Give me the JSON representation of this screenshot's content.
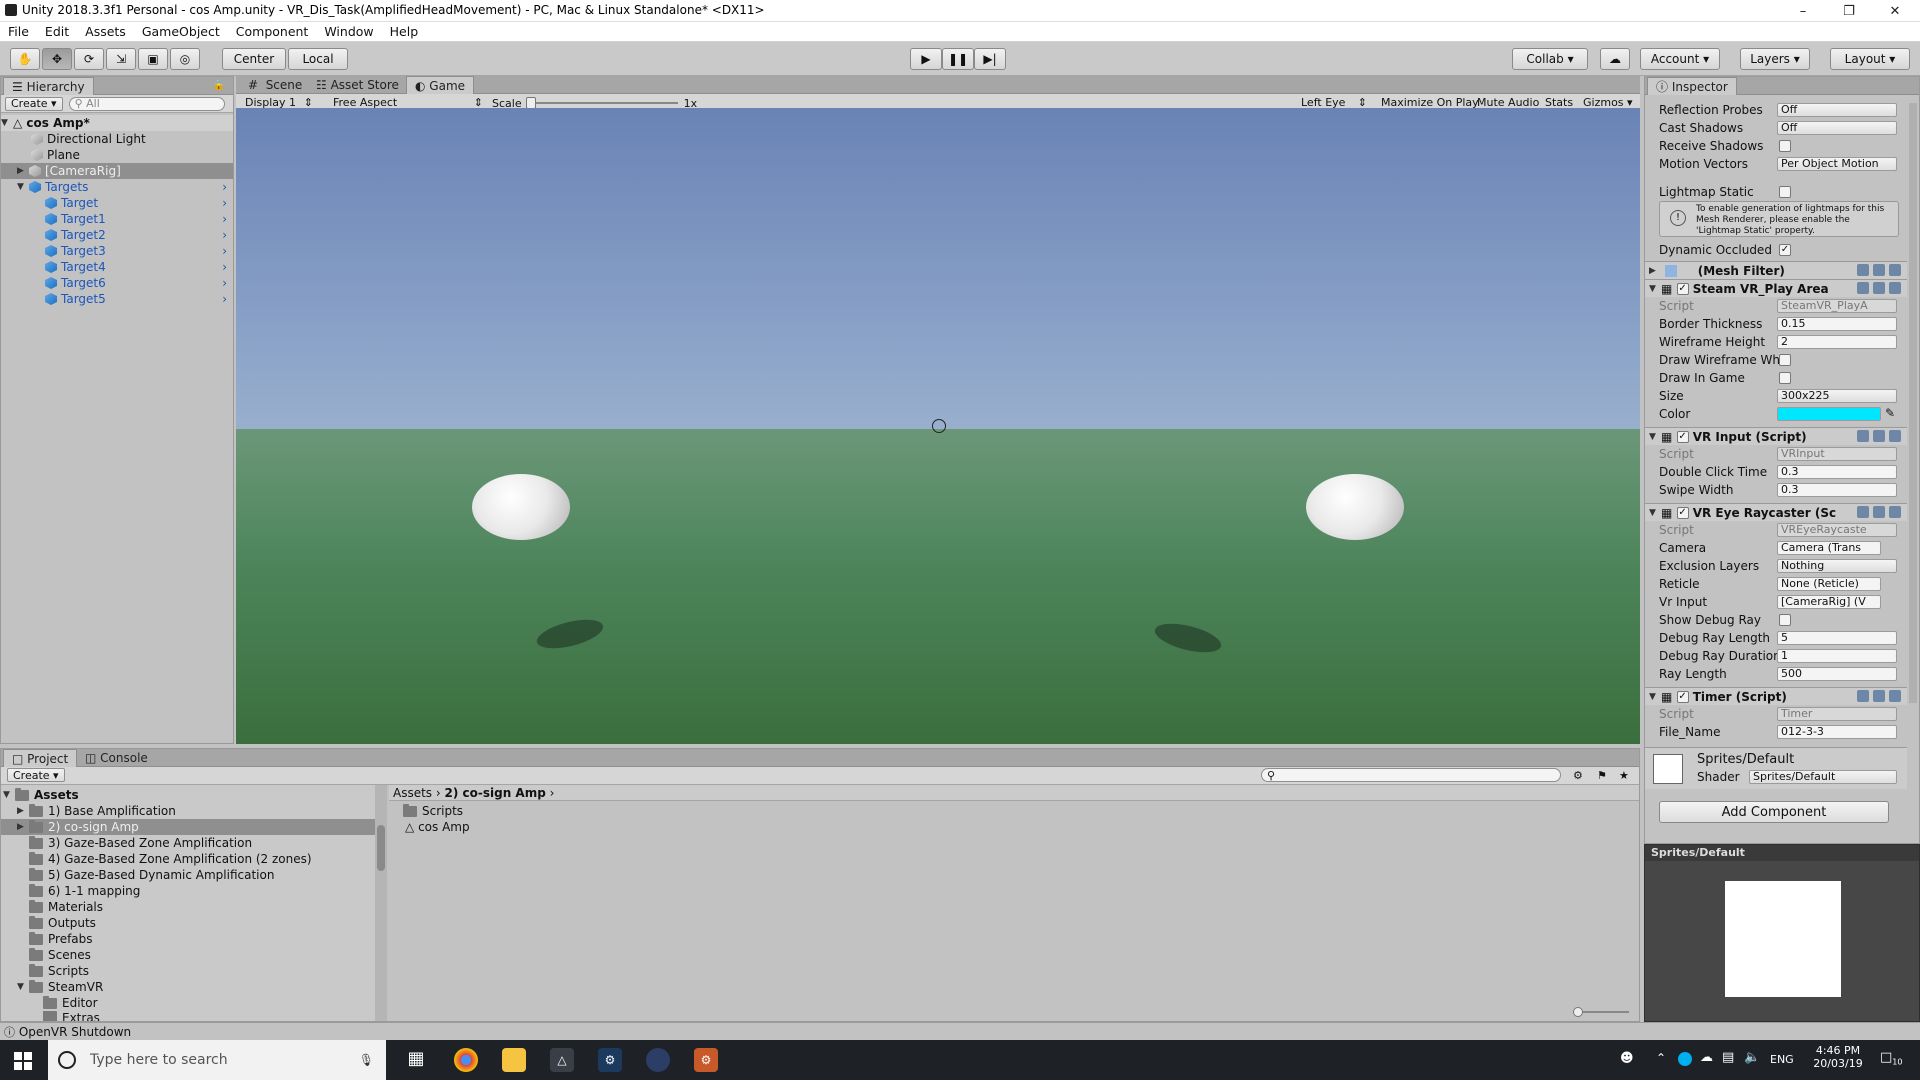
{
  "window": {
    "title": "Unity 2018.3.3f1 Personal - cos Amp.unity - VR_Dis_Task(AmplifiedHeadMovement) - PC, Mac & Linux Standalone* <DX11>"
  },
  "menu": [
    "File",
    "Edit",
    "Assets",
    "GameObject",
    "Component",
    "Window",
    "Help"
  ],
  "toolbar": {
    "pivot": "Center",
    "space": "Local",
    "collab": "Collab",
    "account": "Account",
    "layers": "Layers",
    "layout": "Layout"
  },
  "hierarchy": {
    "tab": "Hierarchy",
    "create": "Create",
    "search_placeholder": "All",
    "scene": "cos Amp*",
    "items": [
      {
        "label": "Directional Light"
      },
      {
        "label": "Plane"
      },
      {
        "label": "[CameraRig]"
      },
      {
        "label": "Targets"
      },
      {
        "label": "Target"
      },
      {
        "label": "Target1"
      },
      {
        "label": "Target2"
      },
      {
        "label": "Target3"
      },
      {
        "label": "Target4"
      },
      {
        "label": "Target6"
      },
      {
        "label": "Target5"
      }
    ]
  },
  "center_tabs": [
    "Scene",
    "Asset Store",
    "Game"
  ],
  "game_bar": {
    "display": "Display 1",
    "aspect": "Free Aspect",
    "scale_label": "Scale",
    "scale_value": "1x",
    "eye": "Left Eye",
    "maximize": "Maximize On Play",
    "mute": "Mute Audio",
    "stats": "Stats",
    "gizmos": "Gizmos"
  },
  "inspector": {
    "tab": "Inspector",
    "renderer": {
      "reflection_probes": {
        "label": "Reflection Probes",
        "value": "Off"
      },
      "cast_shadows": {
        "label": "Cast Shadows",
        "value": "Off"
      },
      "receive_shadows": {
        "label": "Receive Shadows"
      },
      "motion_vectors": {
        "label": "Motion Vectors",
        "value": "Per Object Motion"
      },
      "lightmap_static": {
        "label": "Lightmap Static"
      },
      "info": "To enable generation of lightmaps for this Mesh Renderer, please enable the 'Lightmap Static' property.",
      "dynamic_occluded": {
        "label": "Dynamic Occluded"
      }
    },
    "mesh_filter": "(Mesh Filter)",
    "play_area": {
      "title": "Steam VR_Play Area",
      "script": {
        "label": "Script",
        "value": "SteamVR_PlayA"
      },
      "border": {
        "label": "Border Thickness",
        "value": "0.15"
      },
      "wire_height": {
        "label": "Wireframe Height",
        "value": "2"
      },
      "draw_wire": {
        "label": "Draw Wireframe Wh"
      },
      "draw_game": {
        "label": "Draw In Game"
      },
      "size": {
        "label": "Size",
        "value": "300x225"
      },
      "color": {
        "label": "Color",
        "hex": "#00e6ff"
      }
    },
    "vr_input": {
      "title": "VR Input (Script)",
      "script": {
        "label": "Script",
        "value": "VRInput"
      },
      "double_click": {
        "label": "Double Click Time",
        "value": "0.3"
      },
      "swipe": {
        "label": "Swipe Width",
        "value": "0.3"
      }
    },
    "raycaster": {
      "title": "VR Eye Raycaster (Sc",
      "script": {
        "label": "Script",
        "value": "VREyeRaycaste"
      },
      "camera": {
        "label": "Camera",
        "value": "Camera (Trans"
      },
      "exclusion": {
        "label": "Exclusion Layers",
        "value": "Nothing"
      },
      "reticle": {
        "label": "Reticle",
        "value": "None (Reticle)"
      },
      "vr_input": {
        "label": "Vr Input",
        "value": "[CameraRig] (V"
      },
      "debug_ray": {
        "label": "Show Debug Ray"
      },
      "debug_len": {
        "label": "Debug Ray Length",
        "value": "5"
      },
      "debug_dur": {
        "label": "Debug Ray Duration",
        "value": "1"
      },
      "ray_len": {
        "label": "Ray Length",
        "value": "500"
      }
    },
    "timer": {
      "title": "Timer (Script)",
      "script": {
        "label": "Script",
        "value": "Timer"
      },
      "file_name": {
        "label": "File_Name",
        "value": "012-3-3"
      }
    },
    "material": {
      "name": "Sprites/Default",
      "shader_label": "Shader",
      "shader_value": "Sprites/Default"
    },
    "add_component": "Add Component",
    "preview_title": "Sprites/Default"
  },
  "project": {
    "tabs": [
      "Project",
      "Console"
    ],
    "create": "Create",
    "tree_root": "Assets",
    "tree": [
      "1) Base Amplification",
      "2) co-sign Amp",
      "3) Gaze-Based Zone Amplification",
      "4) Gaze-Based Zone Amplification (2 zones)",
      "5) Gaze-Based Dynamic Amplification",
      "6) 1-1 mapping",
      "Materials",
      "Outputs",
      "Prefabs",
      "Scenes",
      "Scripts",
      "SteamVR",
      "Editor",
      "Extras"
    ],
    "breadcrumb": [
      "Assets",
      "2) co-sign Amp"
    ],
    "files": [
      "Scripts",
      "cos Amp"
    ]
  },
  "status": "OpenVR Shutdown",
  "taskbar": {
    "search_placeholder": "Type here to search",
    "time": "4:46 PM",
    "date": "20/03/19",
    "lang": "ENG",
    "notif": "10"
  }
}
